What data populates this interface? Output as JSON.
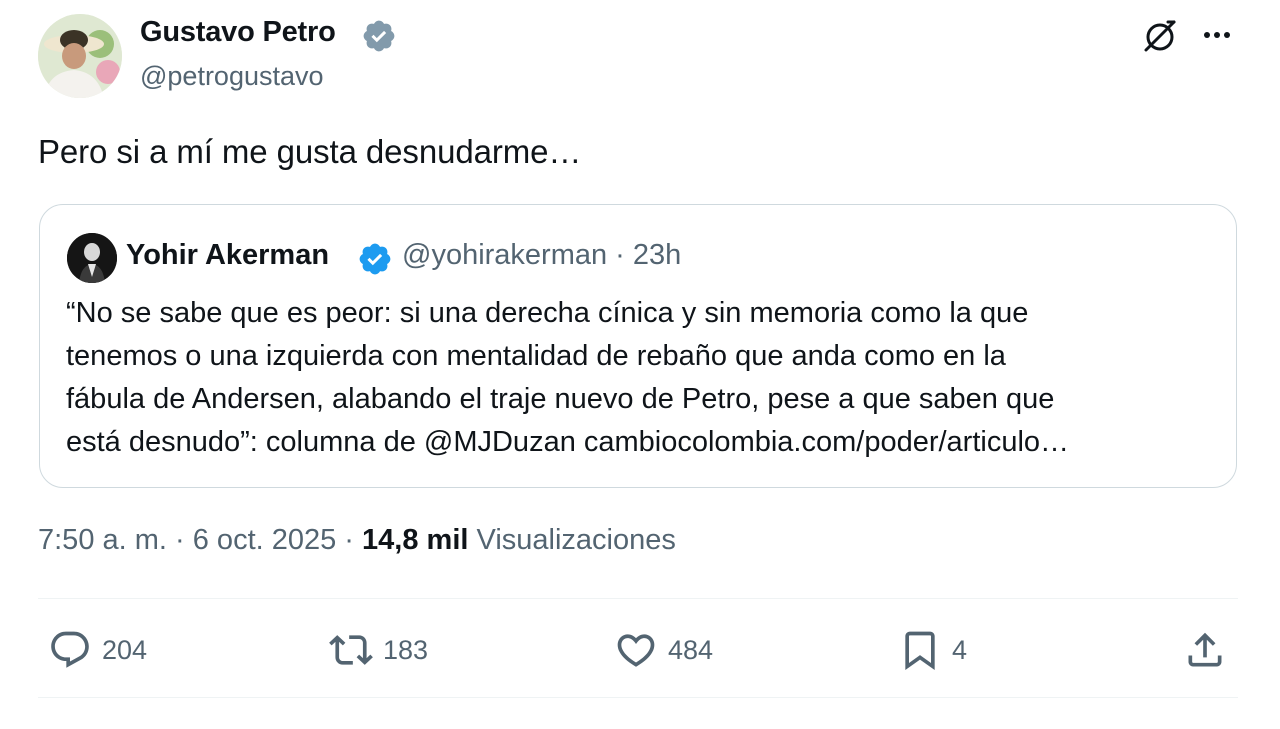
{
  "author": {
    "name": "Gustavo Petro",
    "handle": "@petrogustavo"
  },
  "tweet_text": "Pero si a mí me gusta desnudarme…",
  "quote": {
    "name": "Yohir Akerman",
    "handle": "@yohirakerman",
    "separator": " · ",
    "time": "23h",
    "text_lines": [
      "“No se sabe que es peor: si una derecha cínica y sin memoria como la que",
      "tenemos o una izquierda con mentalidad de rebaño que anda como en la",
      "fábula de Andersen, alabando el traje nuevo de Petro, pese a que saben que",
      "está desnudo”: columna de @MJDuzan cambiocolombia.com/poder/articulo…"
    ]
  },
  "meta": {
    "time": "7:50 a. m.",
    "date": "6 oct. 2025",
    "sep": " · ",
    "views_count": "14,8 mil",
    "views_label": "Visualizaciones"
  },
  "actions": {
    "replies": "204",
    "retweets": "183",
    "likes": "484",
    "bookmarks": "4"
  },
  "icons": {
    "verified": "verified-badge-icon",
    "grok": "grok-icon",
    "more": "more-icon",
    "reply": "reply-icon",
    "retweet": "retweet-icon",
    "like": "heart-icon",
    "bookmark": "bookmark-icon",
    "share": "share-icon"
  },
  "colors": {
    "text": "#0f1419",
    "secondary": "#536471",
    "verified": "#1d9bf0",
    "border": "#cfd9de"
  }
}
